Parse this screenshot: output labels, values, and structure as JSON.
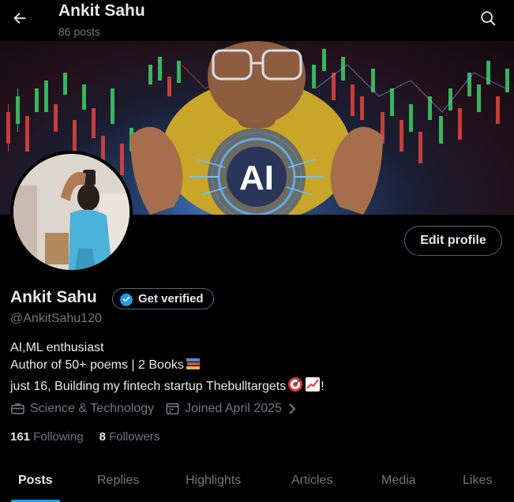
{
  "header": {
    "name": "Ankit Sahu",
    "post_count": "86 posts"
  },
  "profile": {
    "display_name": "Ankit Sahu",
    "get_verified_label": "Get verified",
    "handle": "@AnkitSahu120",
    "edit_profile_label": "Edit profile",
    "bio": [
      "AI,ML enthusiast",
      "Author of 50+ poems | 2 Books",
      "just 16, Building my fintech startup Thebulltargets",
      "!"
    ],
    "category": "Science & Technology",
    "joined": "Joined April 2025",
    "following_count": "161",
    "following_label": "Following",
    "followers_count": "8",
    "followers_label": "Followers"
  },
  "banner": {
    "ai_text": "AI"
  },
  "tabs": [
    {
      "label": "Posts",
      "active": true
    },
    {
      "label": "Replies"
    },
    {
      "label": "Highlights"
    },
    {
      "label": "Articles"
    },
    {
      "label": "Media"
    },
    {
      "label": "Likes"
    }
  ],
  "icons": {
    "back": "arrow-left-icon",
    "search": "search-icon",
    "verified": "verified-badge-icon",
    "category": "briefcase-icon",
    "calendar": "calendar-icon",
    "chevron": "chevron-right-icon"
  },
  "colors": {
    "accent": "#1d9bf0",
    "background": "#000000",
    "text_primary": "#e7e9ea",
    "text_secondary": "#71767b",
    "border": "#536471"
  }
}
